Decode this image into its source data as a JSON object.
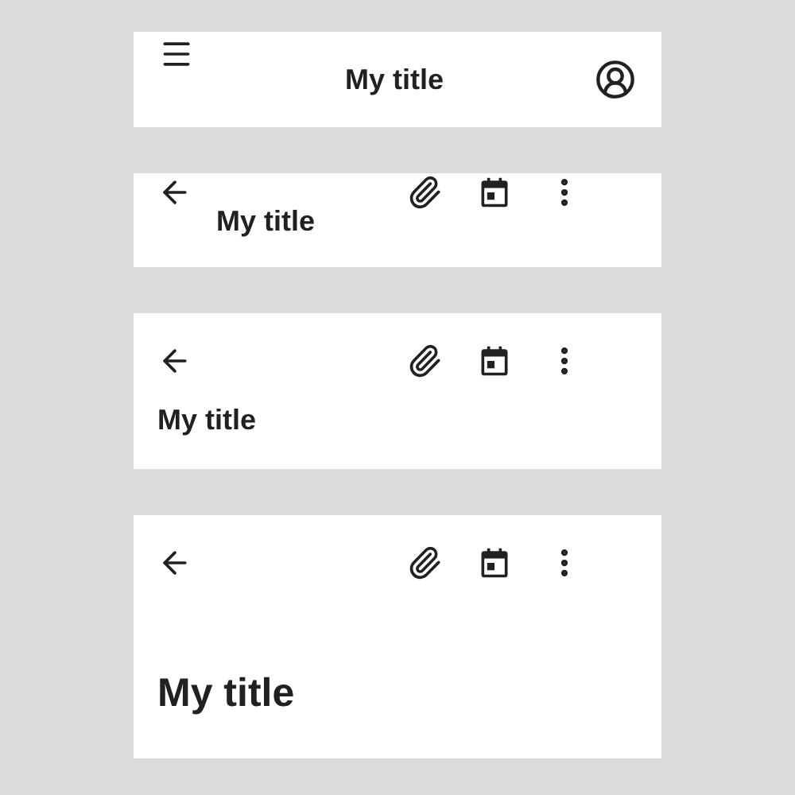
{
  "app_bars": [
    {
      "kind": "center-aligned",
      "title": "My title"
    },
    {
      "kind": "small",
      "title": "My title"
    },
    {
      "kind": "medium",
      "title": "My title"
    },
    {
      "kind": "large",
      "title": "My title"
    }
  ]
}
